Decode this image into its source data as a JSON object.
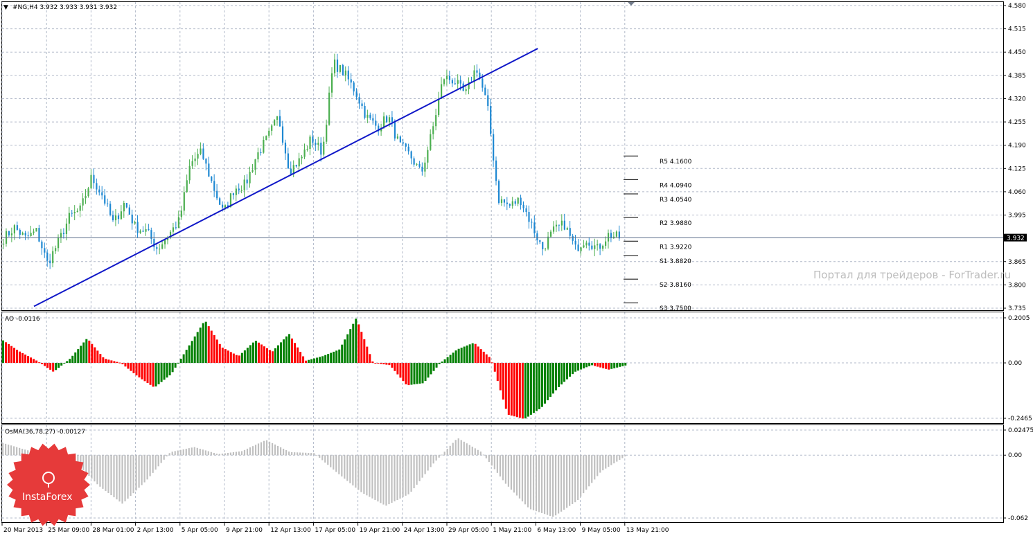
{
  "header": {
    "title": "#NG,H4  3.932 3.933 3.931 3.932"
  },
  "watermark": "Портал для трейдеров - ForTrader.ru",
  "logo": {
    "text": "InstaForex",
    "color": "#e63a3a"
  },
  "colors": {
    "bull": "#4caf50",
    "bear": "#1e88d2",
    "trendline": "#1018c8",
    "ao_up": "#008000",
    "ao_down": "#ff0000",
    "osma": "#c0c0c0",
    "grid": "#b0b8c8",
    "current_price_bg": "#000000"
  },
  "chart_data": [
    {
      "type": "candlestick",
      "title": "#NG,H4",
      "y_ticks": [
        "4.580",
        "4.515",
        "4.450",
        "4.385",
        "4.320",
        "4.255",
        "4.190",
        "4.125",
        "4.060",
        "3.995",
        "3.865",
        "3.800",
        "3.735"
      ],
      "ylim": [
        3.735,
        4.58
      ],
      "current_price": "3.932",
      "x_ticks": [
        "20 Mar 2013",
        "25 Mar 09:00",
        "28 Mar 01:00",
        "2 Apr 13:00",
        "5 Apr 05:00",
        "9 Apr 21:00",
        "12 Apr 13:00",
        "17 Apr 05:00",
        "19 Apr 21:00",
        "24 Apr 13:00",
        "29 Apr 05:00",
        "1 May 21:00",
        "6 May 13:00",
        "9 May 05:00",
        "13 May 21:00"
      ],
      "close_path": [
        3.93,
        3.96,
        3.93,
        3.95,
        3.86,
        3.92,
        3.99,
        4.01,
        4.1,
        4.05,
        3.97,
        4.03,
        3.96,
        3.95,
        3.9,
        3.94,
        3.98,
        4.14,
        4.17,
        4.08,
        4.0,
        4.07,
        4.08,
        4.16,
        4.21,
        4.27,
        4.12,
        4.15,
        4.21,
        4.17,
        4.42,
        4.39,
        4.34,
        4.27,
        4.24,
        4.27,
        4.19,
        4.16,
        4.11,
        4.23,
        4.38,
        4.37,
        4.33,
        4.41,
        4.3,
        4.04,
        4.02,
        4.04,
        3.97,
        3.9,
        3.95,
        3.97,
        3.9,
        3.93,
        3.9,
        3.94,
        3.932
      ],
      "trendline": {
        "start": {
          "x": "20 Mar 2013",
          "y": 3.74
        },
        "end": {
          "x": "1 May 21:00",
          "y": 4.46
        }
      },
      "pivot_levels": [
        {
          "name": "R5",
          "value": 4.16,
          "label": "R5 4.1600"
        },
        {
          "name": "R4",
          "value": 4.094,
          "label": "R4 4.0940"
        },
        {
          "name": "R3",
          "value": 4.054,
          "label": "R3 4.0540"
        },
        {
          "name": "R2",
          "value": 3.988,
          "label": "R2 3.9880"
        },
        {
          "name": "R1",
          "value": 3.922,
          "label": "R1 3.9220"
        },
        {
          "name": "S1",
          "value": 3.882,
          "label": "S1 3.8820"
        },
        {
          "name": "S2",
          "value": 3.816,
          "label": "S2 3.8160"
        },
        {
          "name": "S3",
          "value": 3.75,
          "label": "S3 3.7500"
        }
      ]
    },
    {
      "type": "bar",
      "title": "AO -0.0116",
      "y_ticks": [
        "0.2005",
        "0.00",
        "-0.2465"
      ],
      "ylim": [
        -0.2465,
        0.2005
      ],
      "path": [
        0.1,
        0.05,
        0.01,
        -0.04,
        0.02,
        0.11,
        0.02,
        0.0,
        -0.06,
        -0.11,
        -0.05,
        0.07,
        0.19,
        0.07,
        0.03,
        0.1,
        0.05,
        0.13,
        0.01,
        0.03,
        0.06,
        0.2,
        0.0,
        -0.01,
        -0.1,
        -0.09,
        0.0,
        0.06,
        0.09,
        0.02,
        -0.23,
        -0.25,
        -0.2,
        -0.11,
        -0.04,
        -0.01,
        -0.03,
        -0.0116
      ]
    },
    {
      "type": "bar",
      "title": "OsMA(36,78,27) -0.00127",
      "y_ticks": [
        "0.02475",
        "0.00",
        "-0.062"
      ],
      "ylim": [
        -0.062,
        0.02475
      ],
      "path": [
        0.012,
        0.005,
        0.0,
        -0.006,
        -0.03,
        -0.048,
        -0.025,
        0.003,
        0.008,
        0.001,
        0.004,
        0.015,
        0.003,
        0.002,
        -0.018,
        -0.037,
        -0.05,
        -0.038,
        -0.008,
        0.017,
        0.003,
        -0.028,
        -0.053,
        -0.061,
        -0.045,
        -0.016,
        -0.00127
      ]
    }
  ]
}
